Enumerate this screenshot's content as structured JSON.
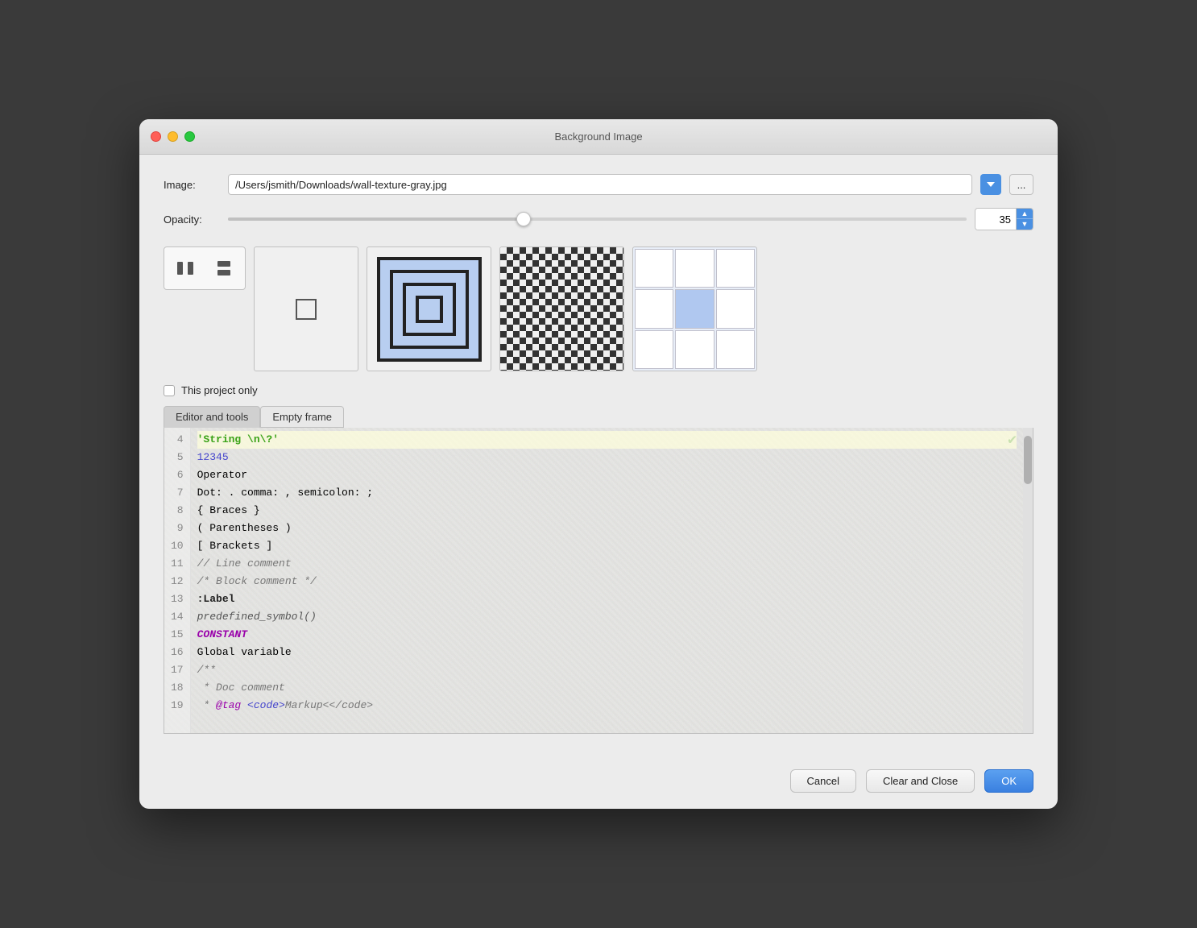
{
  "window": {
    "title": "Background Image"
  },
  "image": {
    "label": "Image:",
    "path": "/Users/jsmith/Downloads/wall-texture-gray.jpg",
    "browse_label": "..."
  },
  "opacity": {
    "label": "Opacity:",
    "value": "35",
    "slider_percent": 40
  },
  "checkbox": {
    "label": "This project only",
    "checked": false
  },
  "tabs": [
    {
      "label": "Editor and tools",
      "active": true
    },
    {
      "label": "Empty frame",
      "active": false
    }
  ],
  "code": {
    "lines": [
      {
        "num": "4",
        "highlighted": true,
        "content": "'String \\n\\?'",
        "type": "string"
      },
      {
        "num": "5",
        "highlighted": false,
        "content": "12345",
        "type": "number"
      },
      {
        "num": "6",
        "highlighted": false,
        "content": "Operator",
        "type": "plain"
      },
      {
        "num": "7",
        "highlighted": false,
        "content": "Dot: . comma: , semicolon: ;",
        "type": "plain"
      },
      {
        "num": "8",
        "highlighted": false,
        "content": "{ Braces }",
        "type": "plain"
      },
      {
        "num": "9",
        "highlighted": false,
        "content": "( Parentheses )",
        "type": "plain"
      },
      {
        "num": "10",
        "highlighted": false,
        "content": "[ Brackets ]",
        "type": "plain"
      },
      {
        "num": "11",
        "highlighted": false,
        "content": "// Line comment",
        "type": "comment"
      },
      {
        "num": "12",
        "highlighted": false,
        "content": "/* Block comment */",
        "type": "comment"
      },
      {
        "num": "13",
        "highlighted": false,
        "content": ":Label",
        "type": "label"
      },
      {
        "num": "14",
        "highlighted": false,
        "content": "predefined_symbol()",
        "type": "predefined"
      },
      {
        "num": "15",
        "highlighted": false,
        "content": "CONSTANT",
        "type": "constant"
      },
      {
        "num": "16",
        "highlighted": false,
        "content": "Global variable",
        "type": "plain"
      },
      {
        "num": "17",
        "highlighted": false,
        "content": "/**",
        "type": "comment"
      },
      {
        "num": "18",
        "highlighted": false,
        "content": " * Doc comment",
        "type": "comment"
      },
      {
        "num": "19",
        "highlighted": false,
        "content": " * @tag <code>Markup<</code>",
        "type": "doccomment"
      }
    ]
  },
  "buttons": {
    "cancel": "Cancel",
    "clear_close": "Clear and Close",
    "ok": "OK"
  }
}
